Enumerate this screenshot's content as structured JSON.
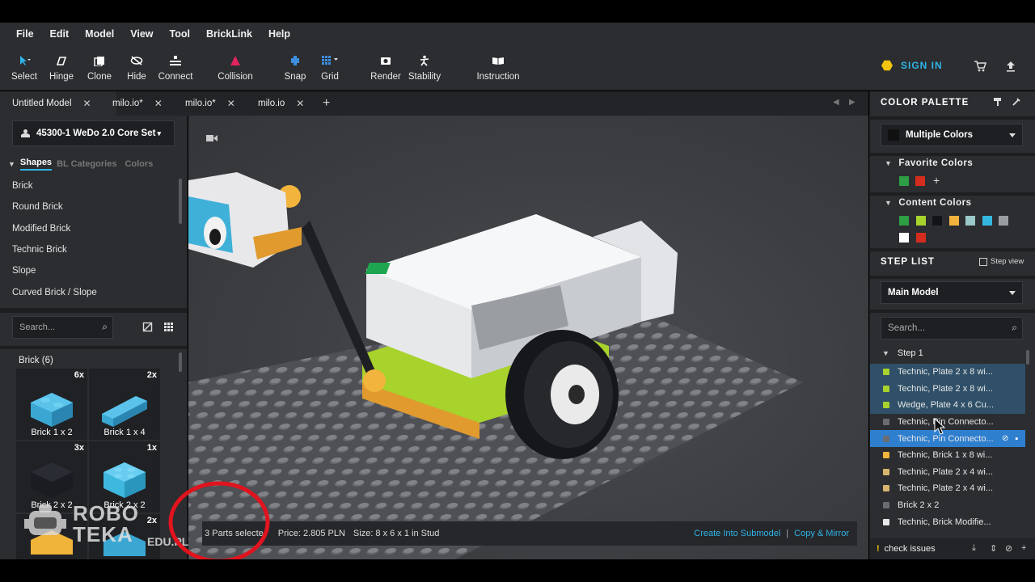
{
  "menu": [
    "File",
    "Edit",
    "Model",
    "View",
    "Tool",
    "BrickLink",
    "Help"
  ],
  "toolbar": {
    "tools": [
      {
        "label": "Select",
        "icon": "cursor-icon"
      },
      {
        "label": "Hinge",
        "icon": "hinge-icon"
      },
      {
        "label": "Clone",
        "icon": "clone-icon"
      },
      {
        "label": "Hide",
        "icon": "hide-icon"
      },
      {
        "label": "Connect",
        "icon": "connect-icon"
      },
      {
        "label": "Collision",
        "icon": "collision-icon"
      },
      {
        "label": "Snap",
        "icon": "snap-icon"
      },
      {
        "label": "Grid",
        "icon": "grid-icon"
      },
      {
        "label": "Render",
        "icon": "camera-icon"
      },
      {
        "label": "Stability",
        "icon": "stability-icon"
      },
      {
        "label": "Instruction",
        "icon": "book-icon"
      }
    ],
    "signin": "SIGN IN"
  },
  "tabs": [
    {
      "label": "Untitled Model"
    },
    {
      "label": "milo.io*"
    },
    {
      "label": "milo.io*"
    },
    {
      "label": "milo.io"
    }
  ],
  "left": {
    "set_selector": "45300-1 WeDo 2.0 Core Set",
    "filter_tabs": [
      "Shapes",
      "BL Categories",
      "Colors"
    ],
    "shapes": [
      "Brick",
      "Round Brick",
      "Modified Brick",
      "Technic Brick",
      "Slope",
      "Curved Brick / Slope"
    ],
    "search_placeholder": "Search...",
    "category_header": "Brick (6)",
    "bricks": [
      {
        "name": "Brick 1 x 2",
        "count": "6x",
        "color": "#3aa7d3"
      },
      {
        "name": "Brick 1 x 4",
        "count": "2x",
        "color": "#3aa7d3"
      },
      {
        "name": "Brick 2 x 2",
        "count": "3x",
        "color": "#1a1c21"
      },
      {
        "name": "Brick 2 x 2",
        "count": "1x",
        "color": "#3fb8e0"
      },
      {
        "name": "",
        "count": "2x",
        "color": "#f0b43a"
      }
    ]
  },
  "watermark": {
    "brand": "ROBO TEKA",
    "domain": "EDU.PL"
  },
  "viewport": {
    "selected_info": "3 Parts selecte",
    "price": "Price: 2.805 PLN",
    "size": "Size: 8 x 6 x 1 in Stud",
    "action_submodel": "Create Into Submodel",
    "action_sep": "|",
    "action_copy": "Copy & Mirror"
  },
  "right": {
    "palette_title": "COLOR PALETTE",
    "palette_selector": "Multiple Colors",
    "favorite_title": "Favorite Colors",
    "favorite_colors": [
      "#2e9e44",
      "#d42d1e"
    ],
    "content_title": "Content Colors",
    "content_colors": [
      "#2e9e44",
      "#a8d22c",
      "#121417",
      "#f2b43c",
      "#9bc8c9",
      "#35b8e0",
      "#9a9da1",
      "#ffffff",
      "#d42d1e"
    ],
    "step_list_title": "STEP LIST",
    "step_view_label": "Step view",
    "model_selector": "Main Model",
    "search_placeholder": "Search...",
    "step_header": "Step 1",
    "steps": [
      {
        "label": "Technic, Plate 2 x 8 wi...",
        "color": "#a8d22c",
        "state": "sel"
      },
      {
        "label": "Technic, Plate 2 x 8 wi...",
        "color": "#a8d22c",
        "state": "sel"
      },
      {
        "label": "Wedge, Plate 4 x 6 Cu...",
        "color": "#a8d22c",
        "state": "sel"
      },
      {
        "label": "Technic, Pin Connecto...",
        "color": "#6a6c70",
        "state": "none"
      },
      {
        "label": "Technic, Pin Connecto...",
        "color": "#6a6c70",
        "state": "sel2"
      },
      {
        "label": "Technic, Brick 1 x 8 wi...",
        "color": "#f2b43c",
        "state": "none"
      },
      {
        "label": "Technic, Plate 2 x 4 wi...",
        "color": "#d8b470",
        "state": "none"
      },
      {
        "label": "Technic, Plate 2 x 4 wi...",
        "color": "#d8b470",
        "state": "none"
      },
      {
        "label": "Brick 2 x 2",
        "color": "#6a6c70",
        "state": "none"
      },
      {
        "label": "Technic, Brick Modifie...",
        "color": "#e8e8e8",
        "state": "none"
      }
    ],
    "check_issues": "check issues"
  }
}
